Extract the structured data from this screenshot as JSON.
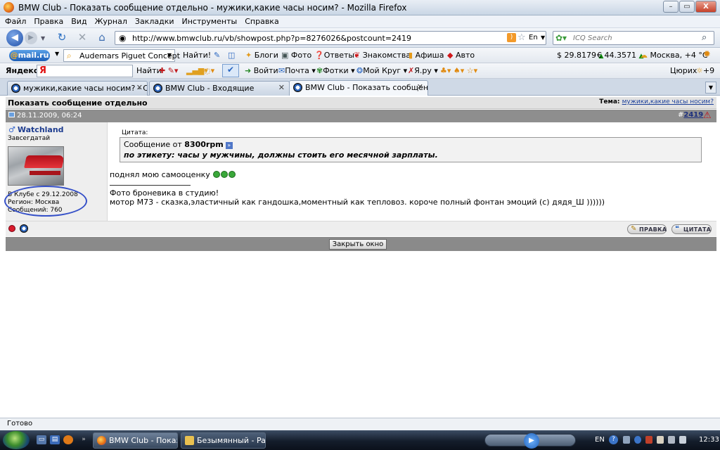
{
  "window": {
    "title": "BMW Club - Показать сообщение отдельно - мужики,какие часы носим? - Mozilla Firefox",
    "minimize": "–",
    "maximize": "▭",
    "close": "X"
  },
  "menu": [
    "Файл",
    "Правка",
    "Вид",
    "Журнал",
    "Закладки",
    "Инструменты",
    "Справка"
  ],
  "nav": {
    "back_icon": "arrow-left-icon",
    "forward_icon": "arrow-right-icon",
    "url": "http://www.bmwclub.ru/vb/showpost.php?p=8276026&postcount=2419",
    "lang": "En",
    "icq_placeholder": "ICQ Search"
  },
  "mailbar": {
    "logo_at": "@",
    "logo_text": "mail.ru",
    "search_value": "Audemars Piguet Concept",
    "find": "Найти!",
    "links": [
      "Блоги",
      "Фото",
      "Ответы",
      "Знакомства",
      "Афиша",
      "Авто"
    ],
    "usd": "$ 29.8179",
    "eur": "€ 44.3571",
    "weather": "Москва, +4 °C"
  },
  "yabar": {
    "logo": "Яндекс",
    "search_logo": "Я",
    "find": "Найти",
    "links": [
      "Войти",
      "Почта",
      "Фотки",
      "Мой Круг",
      "Я.ру"
    ],
    "city": "Цюрих",
    "temp": "+9"
  },
  "tabs": [
    {
      "label": "мужики,какие часы носим? - Стр...",
      "active": false
    },
    {
      "label": "BMW Club - Входящие",
      "active": false
    },
    {
      "label": "BMW Club - Показать сообщени...",
      "active": true
    }
  ],
  "page": {
    "header": "Показать сообщение отдельно",
    "thread_label": "Тема:",
    "thread_link": "мужики,какие часы носим?",
    "date": "28.11.2009, 06:24",
    "post_hash": "#",
    "post_number": "2419",
    "user": {
      "name": "Watchland",
      "rank": "Завсегдатай",
      "joined": "В Клубе с 29.12.2008",
      "region": "Регион: Москва",
      "posts": "Сообщений: 760"
    },
    "quote_label": "Цитата:",
    "quote_from_prefix": "Сообщение от",
    "quote_author": "8300rpm",
    "quote_text": "по этикету: часы у мужчины, должны стоить его месячной зарплаты.",
    "line1": "поднял мою самооценку",
    "line2": "Фото броневика в студию!",
    "line3": "мотор M73 - сказка,эластичный как гандошка,моментный как тепловоз. короче полный фонтан эмоций (с) дядя_Ш ))))))",
    "edit_btn": "ПРАВКА",
    "quote_btn": "ЦИТАТА",
    "close_btn": "Закрыть окно"
  },
  "status": "Готово",
  "taskbar": {
    "tasks": [
      "BMW Club - Показа...",
      "Безымянный - Paint"
    ],
    "lang": "EN",
    "time": "12:33"
  }
}
